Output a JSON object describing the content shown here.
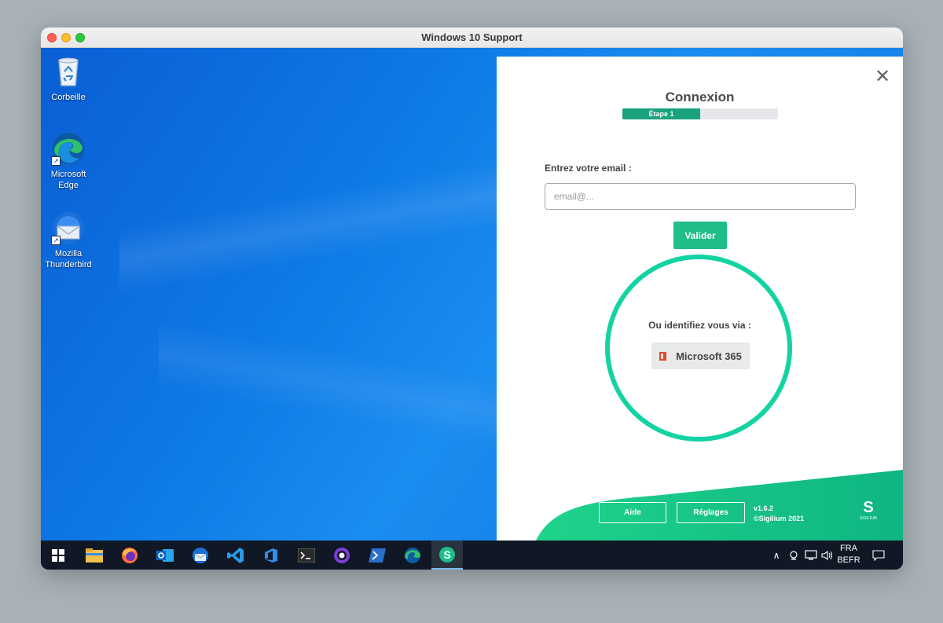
{
  "window": {
    "title": "Windows 10 Support"
  },
  "desktop": {
    "icons": [
      {
        "label": "Corbeille"
      },
      {
        "label_line1": "Microsoft",
        "label_line2": "Edge"
      },
      {
        "label_line1": "Mozilla",
        "label_line2": "Thunderbird"
      }
    ]
  },
  "dialog": {
    "title": "Connexion",
    "step_label": "Étape 1",
    "step_progress": 0.5,
    "email_label": "Entrez votre email :",
    "email_placeholder": "email@...",
    "email_value": "",
    "submit_label": "Valider",
    "alt_label": "Ou identifiez vous via :",
    "provider_label": "Microsoft 365",
    "footer": {
      "help_label": "Aide",
      "settings_label": "Réglages",
      "version": "v1.6.2",
      "copyright": "©Sigilium 2021",
      "logo_letter": "S",
      "logo_name": "SIGILIUM"
    },
    "colors": {
      "accent": "#1ebd8a",
      "ring": "#13d3a3",
      "progress": "#19a27c"
    }
  },
  "taskbar": {
    "apps": [
      "start-icon",
      "file-explorer-icon",
      "firefox-icon",
      "outlook-icon",
      "thunderbird-icon",
      "vscode-icon",
      "azure-devops-icon",
      "terminal-icon",
      "github-desktop-icon",
      "powershell-icon",
      "edge-icon",
      "sigilium-icon"
    ],
    "language_line1": "FRA",
    "language_line2": "BEFR"
  }
}
